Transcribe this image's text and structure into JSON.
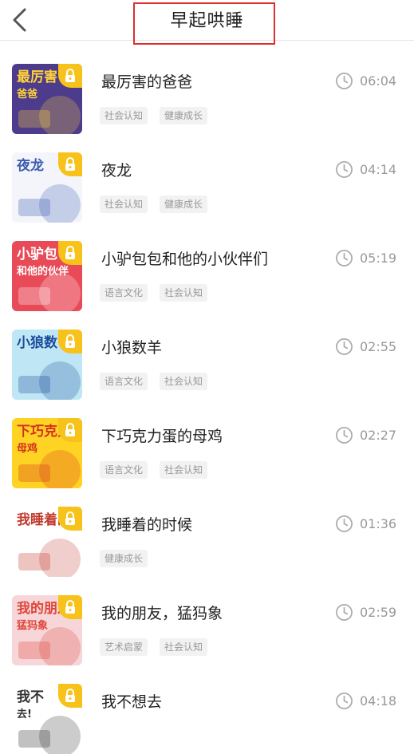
{
  "header": {
    "title": "早起哄睡",
    "back_icon": "chevron-left-icon"
  },
  "colors": {
    "accent_lock": "#f7c21a",
    "highlight_box": "#e02d2d",
    "muted_text": "#999999",
    "tag_bg": "#f2f2f2"
  },
  "items": [
    {
      "title": "最厉害的爸爸",
      "duration": "06:04",
      "tags": [
        "社会认知",
        "健康成长"
      ],
      "cover_text": "最厉害\n爸爸",
      "cover_bg": "#4d3c8c",
      "cover_fg": "#ffd23a"
    },
    {
      "title": "夜龙",
      "duration": "04:14",
      "tags": [
        "社会认知",
        "健康成长"
      ],
      "cover_text": "夜龙",
      "cover_bg": "#f3f5fb",
      "cover_fg": "#3a5bb0"
    },
    {
      "title": "小驴包包和他的小伙伴们",
      "duration": "05:19",
      "tags": [
        "语言文化",
        "社会认知"
      ],
      "cover_text": "小驴包\n和他的伙伴",
      "cover_bg": "#e84a58",
      "cover_fg": "#ffffff"
    },
    {
      "title": "小狼数羊",
      "duration": "02:55",
      "tags": [
        "语言文化",
        "社会认知"
      ],
      "cover_text": "小狼数",
      "cover_bg": "#bfe6f5",
      "cover_fg": "#1d4d9a"
    },
    {
      "title": "下巧克力蛋的母鸡",
      "duration": "02:27",
      "tags": [
        "语言文化",
        "社会认知"
      ],
      "cover_text": "下巧克力\n母鸡",
      "cover_bg": "#ffd324",
      "cover_fg": "#d3321e"
    },
    {
      "title": "我睡着的时候",
      "duration": "01:36",
      "tags": [
        "健康成长"
      ],
      "cover_text": "我睡着的",
      "cover_bg": "#ffffff",
      "cover_fg": "#c23c2e"
    },
    {
      "title": "我的朋友，猛犸象",
      "duration": "02:59",
      "tags": [
        "艺术启蒙",
        "社会认知"
      ],
      "cover_text": "我的朋友\n猛犸象",
      "cover_bg": "#f6d6d9",
      "cover_fg": "#e0463a"
    },
    {
      "title": "我不想去",
      "duration": "04:18",
      "tags": [],
      "cover_text": "我不\n去!",
      "cover_bg": "#ffffff",
      "cover_fg": "#333333"
    }
  ]
}
